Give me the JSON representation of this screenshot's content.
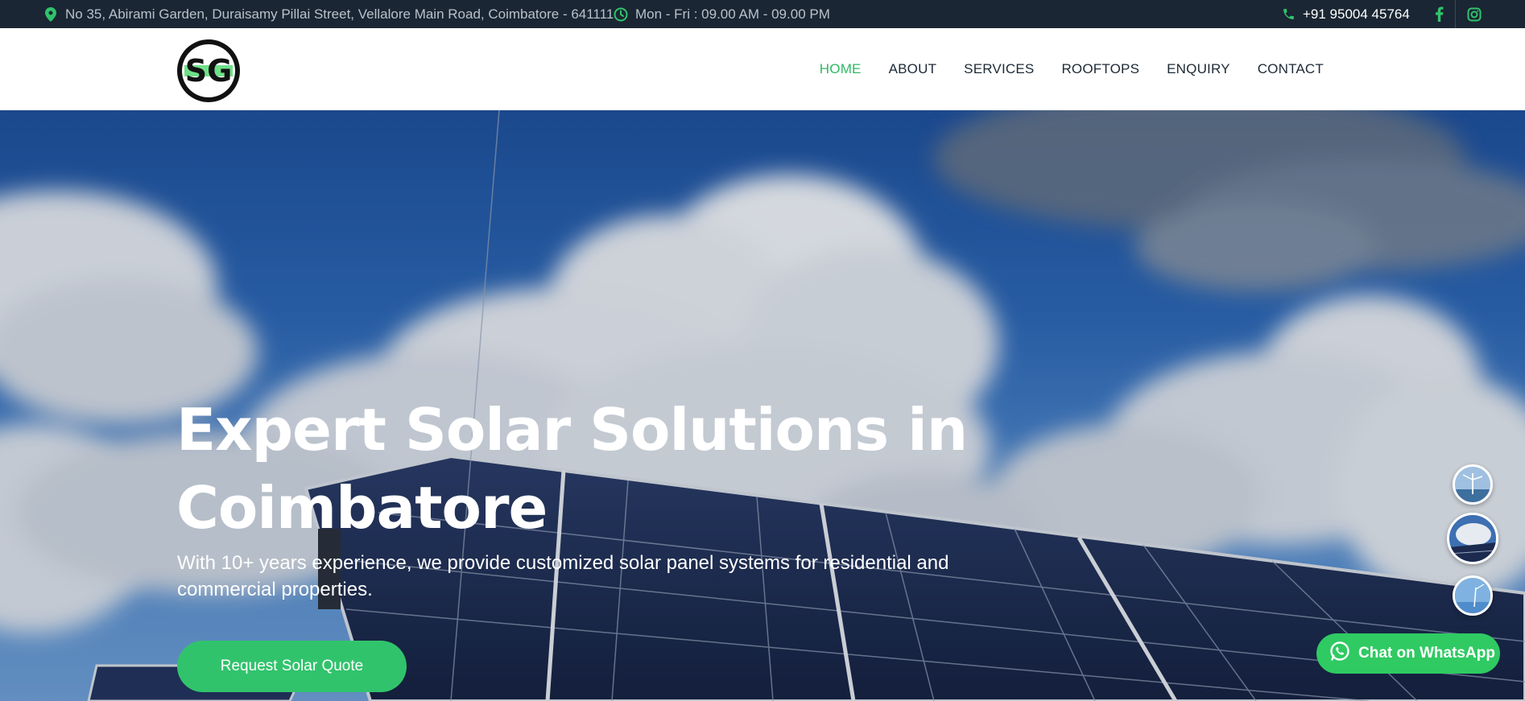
{
  "topbar": {
    "address": "No 35, Abirami Garden, Duraisamy Pillai Street, Vellalore Main Road, Coimbatore - 641111",
    "hours": "Mon - Fri : 09.00 AM - 09.00 PM",
    "phone": "+91 95004 45764",
    "icons": [
      "map-pin-icon",
      "clock-icon",
      "phone-icon",
      "facebook-icon",
      "instagram-icon"
    ]
  },
  "brand": {
    "logo_text": "SG"
  },
  "nav": {
    "items": [
      {
        "label": "HOME",
        "active": true
      },
      {
        "label": "ABOUT",
        "active": false
      },
      {
        "label": "SERVICES",
        "active": false
      },
      {
        "label": "ROOFTOPS",
        "active": false
      },
      {
        "label": "ENQUIRY",
        "active": false
      },
      {
        "label": "CONTACT",
        "active": false
      }
    ]
  },
  "hero": {
    "title_line1": "Expert Solar Solutions in",
    "title_line2": "Coimbatore",
    "subtitle_line1": "With 10+ years experience, we provide customized solar panel systems for residential and",
    "subtitle_line2": "commercial properties.",
    "cta_label": "Request Solar Quote"
  },
  "whatsapp": {
    "label": "Chat on WhatsApp"
  },
  "colors": {
    "accent": "#31c36c",
    "topbar": "#1a2633",
    "nav_text": "#1e2a36"
  }
}
